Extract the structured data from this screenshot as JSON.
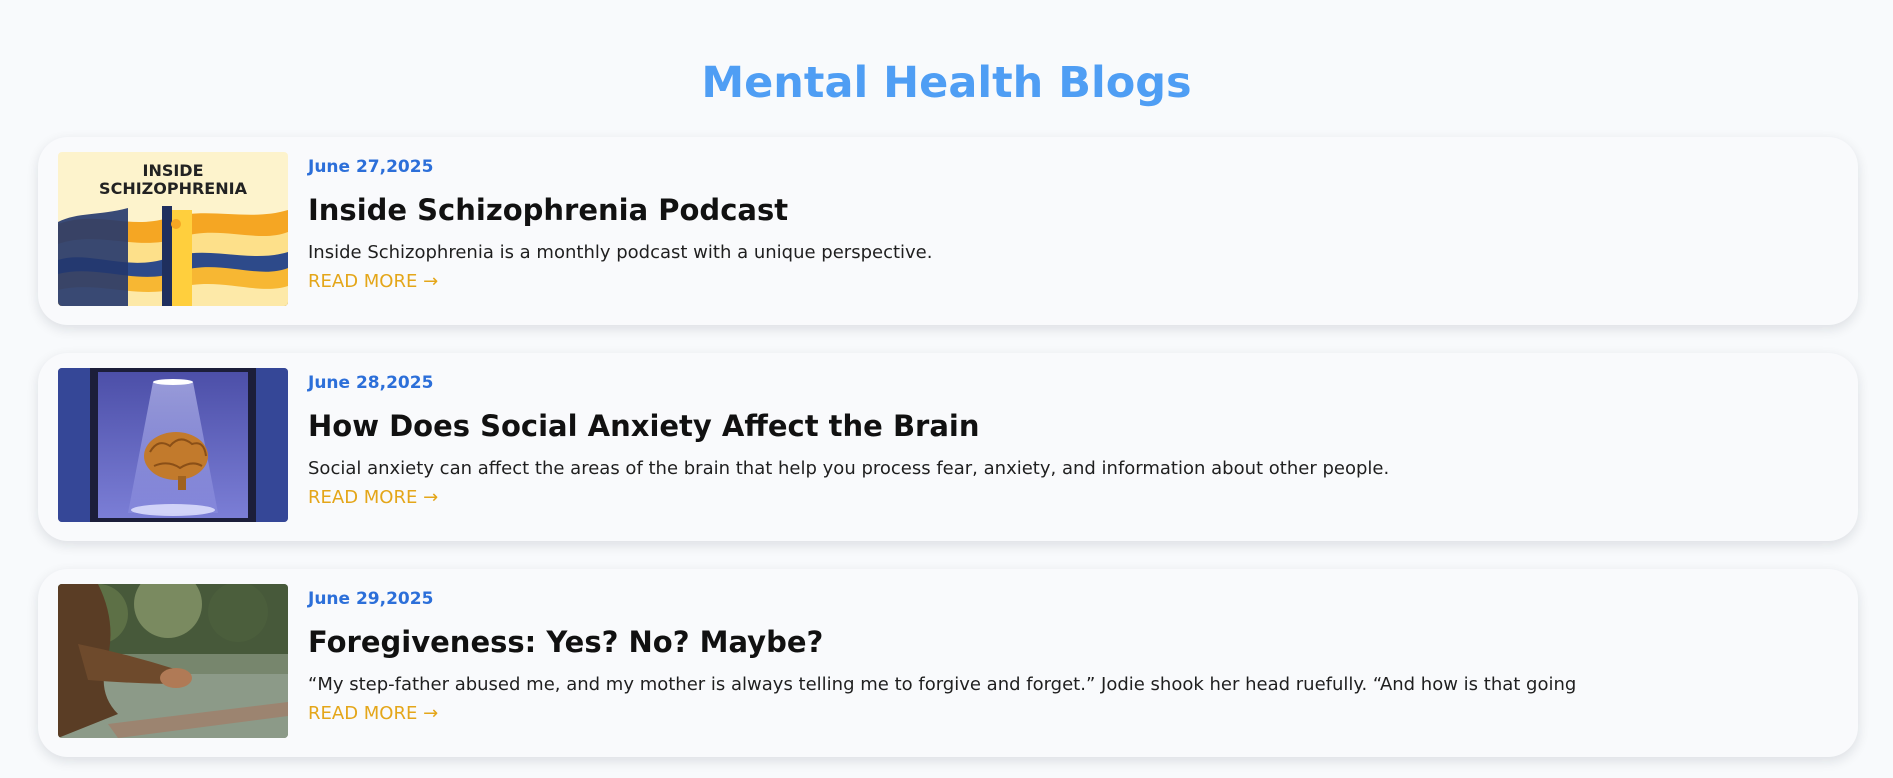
{
  "page": {
    "title": "Mental Health Blogs",
    "title_color": "#4f9ef4",
    "date_color": "#2c6fd9",
    "link_color": "#e4a619"
  },
  "posts": [
    {
      "date": "June 27,2025",
      "title": "Inside Schizophrenia Podcast",
      "excerpt": "Inside Schizophrenia is a monthly podcast with a unique perspective.",
      "read_more": "READ MORE →",
      "image": {
        "text_line1": "INSIDE",
        "text_line2": "SCHIZOPHRENIA"
      }
    },
    {
      "date": "June 28,2025",
      "title": "How Does Social Anxiety Affect the Brain",
      "excerpt": "Social anxiety can affect the areas of the brain that help you process fear, anxiety, and information about other people.",
      "read_more": "READ MORE →"
    },
    {
      "date": "June 29,2025",
      "title": "Foregiveness: Yes? No? Maybe?",
      "excerpt": "“My step-father abused me, and my mother is always telling me to forgive and forget.” Jodie shook her head ruefully. “And how is that going",
      "read_more": "READ MORE →"
    }
  ]
}
